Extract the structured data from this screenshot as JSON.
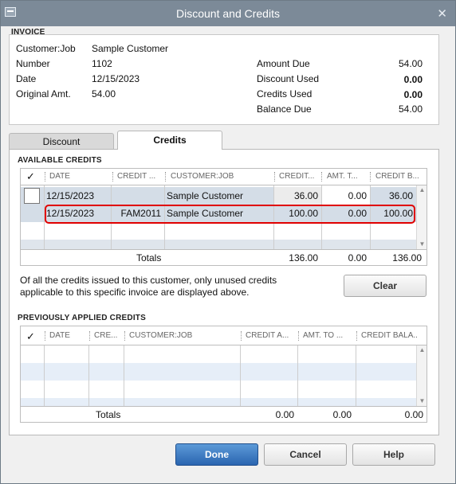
{
  "window": {
    "title": "Discount and Credits",
    "close_glyph": "✕"
  },
  "invoice": {
    "section_label": "INVOICE",
    "customer_job_label": "Customer:Job",
    "customer_job": "Sample Customer",
    "number_label": "Number",
    "number": "1102",
    "date_label": "Date",
    "date": "12/15/2023",
    "original_amt_label": "Original Amt.",
    "original_amt": "54.00",
    "amount_due_label": "Amount Due",
    "amount_due": "54.00",
    "discount_used_label": "Discount Used",
    "discount_used": "0.00",
    "credits_used_label": "Credits Used",
    "credits_used": "0.00",
    "balance_due_label": "Balance Due",
    "balance_due": "54.00"
  },
  "tabs": {
    "discount": "Discount",
    "credits": "Credits",
    "active": "Credits"
  },
  "available_credits": {
    "section_label": "AVAILABLE CREDITS",
    "headers": {
      "check": "✓",
      "date": "DATE",
      "credit_no": "CREDIT ...",
      "customer_job": "CUSTOMER:JOB",
      "credit_amt": "CREDIT...",
      "amt_to_use": "AMT. T...",
      "credit_balance": "CREDIT B..."
    },
    "rows": [
      {
        "date": "12/15/2023",
        "credit_no": "",
        "customer_job": "Sample Customer",
        "credit_amt": "36.00",
        "amt_to_use": "0.00",
        "credit_balance": "36.00"
      },
      {
        "date": "12/15/2023",
        "credit_no": "FAM2011",
        "customer_job": "Sample Customer",
        "credit_amt": "100.00",
        "amt_to_use": "0.00",
        "credit_balance": "100.00"
      }
    ],
    "totals_label": "Totals",
    "total_credit_amt": "136.00",
    "total_amt_to_use": "0.00",
    "total_credit_balance": "136.00",
    "note": "Of all the credits issued to this customer, only unused credits applicable to this specific invoice are displayed above.",
    "clear_button": "Clear"
  },
  "previously_applied": {
    "section_label": "PREVIOUSLY APPLIED CREDITS",
    "headers": {
      "check": "✓",
      "date": "DATE",
      "credit_no": "CRE...",
      "customer_job": "CUSTOMER:JOB",
      "credit_amt": "CREDIT A...",
      "amt_to_use": "AMT. TO ...",
      "credit_balance": "CREDIT BALA..."
    },
    "totals_label": "Totals",
    "total_credit_amt": "0.00",
    "total_amt_to_use": "0.00",
    "total_credit_balance": "0.00"
  },
  "buttons": {
    "done": "Done",
    "cancel": "Cancel",
    "help": "Help"
  },
  "colors": {
    "titlebar": "#7c8a98",
    "highlight": "#e00000",
    "row_stripe": "#e6eef8",
    "selected_row": "#d4dde7",
    "done_button": "#2a65b0"
  }
}
